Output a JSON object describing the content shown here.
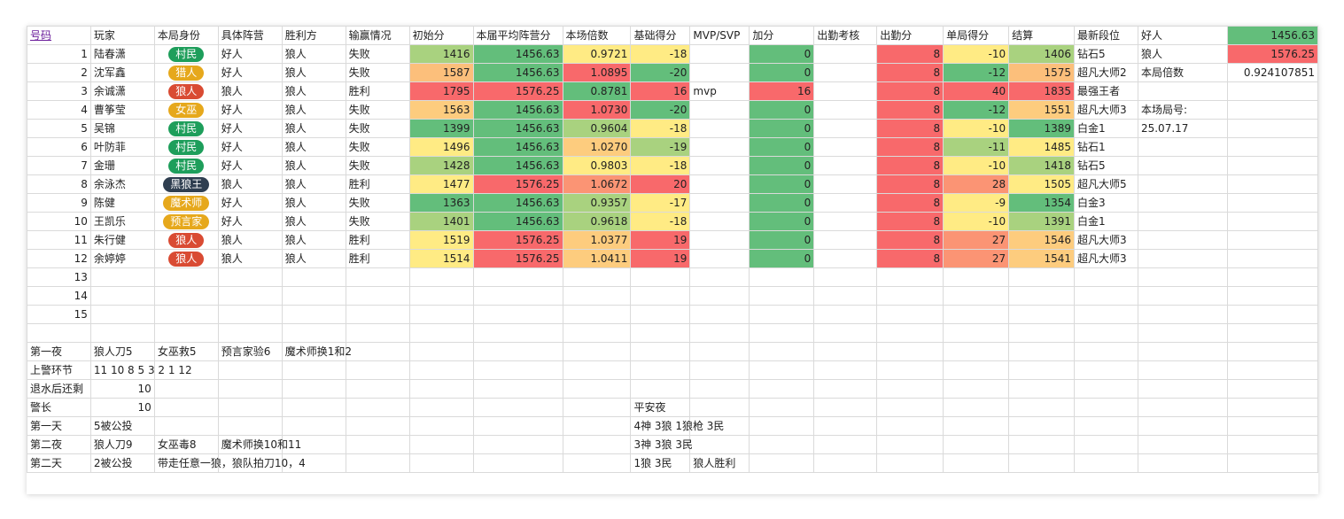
{
  "colors": {
    "green": "#63be7b",
    "lightgreen": "#a9d27f",
    "yellow": "#ffeb84",
    "orange": "#fcbf7b",
    "lightorange": "#fdcc7e",
    "salmon": "#fb9474",
    "red": "#f8696b",
    "pill_green": "#1e9e5b",
    "pill_yellow": "#e6a81c",
    "pill_red": "#d94b33",
    "pill_dark": "#2f3e50"
  },
  "headers": [
    "号码",
    "玩家",
    "本局身份",
    "具体阵营",
    "胜利方",
    "输赢情况",
    "初始分",
    "本届平均阵营分",
    "本场倍数",
    "基础得分",
    "MVP/SVP",
    "加分",
    "出勤考核",
    "出勤分",
    "单局得分",
    "结算",
    "最新段位",
    "好人",
    "1456.63"
  ],
  "side": {
    "r1": {
      "label": "狼人",
      "value": "1576.25"
    },
    "r2": {
      "label": "本局倍数",
      "value": "0.924107851"
    },
    "r4": {
      "label": "本场局号:"
    },
    "r5": {
      "label": "25.07.17"
    }
  },
  "players": [
    {
      "no": "1",
      "name": "陆春潇",
      "role": "村民",
      "pill": "green",
      "camp": "好人",
      "winner": "狼人",
      "result": "失败",
      "init": "1416",
      "avg": "1456.63",
      "mult": "0.9721",
      "base": "-18",
      "mvp": "",
      "bonus": "0",
      "att": "",
      "att_score": "8",
      "game": "-10",
      "settle": "1406",
      "rank": "钻石5",
      "c_init": "lightgreen",
      "c_avg": "green",
      "c_mult": "yellow",
      "c_base": "yellow",
      "c_game": "yellow",
      "c_settle": "lightgreen"
    },
    {
      "no": "2",
      "name": "沈军鑫",
      "role": "猎人",
      "pill": "yellow",
      "camp": "好人",
      "winner": "狼人",
      "result": "失败",
      "init": "1587",
      "avg": "1456.63",
      "mult": "1.0895",
      "base": "-20",
      "mvp": "",
      "bonus": "0",
      "att": "",
      "att_score": "8",
      "game": "-12",
      "settle": "1575",
      "rank": "超凡大师2",
      "c_init": "orange",
      "c_avg": "green",
      "c_mult": "red",
      "c_base": "green",
      "c_game": "green",
      "c_settle": "orange"
    },
    {
      "no": "3",
      "name": "余诚潇",
      "role": "狼人",
      "pill": "red",
      "camp": "狼人",
      "winner": "狼人",
      "result": "胜利",
      "init": "1795",
      "avg": "1576.25",
      "mult": "0.8781",
      "base": "16",
      "mvp": "mvp",
      "bonus": "16",
      "att": "",
      "att_score": "8",
      "game": "40",
      "settle": "1835",
      "rank": "最强王者",
      "c_init": "red",
      "c_avg": "red",
      "c_mult": "green",
      "c_base": "red",
      "c_game": "red",
      "c_settle": "red",
      "c_bonus": "red"
    },
    {
      "no": "4",
      "name": "曹筝莹",
      "role": "女巫",
      "pill": "yellow",
      "camp": "好人",
      "winner": "狼人",
      "result": "失败",
      "init": "1563",
      "avg": "1456.63",
      "mult": "1.0730",
      "base": "-20",
      "mvp": "",
      "bonus": "0",
      "att": "",
      "att_score": "8",
      "game": "-12",
      "settle": "1551",
      "rank": "超凡大师3",
      "c_init": "lightorange",
      "c_avg": "green",
      "c_mult": "red",
      "c_base": "green",
      "c_game": "green",
      "c_settle": "lightorange"
    },
    {
      "no": "5",
      "name": "吴锦",
      "role": "村民",
      "pill": "green",
      "camp": "好人",
      "winner": "狼人",
      "result": "失败",
      "init": "1399",
      "avg": "1456.63",
      "mult": "0.9604",
      "base": "-18",
      "mvp": "",
      "bonus": "0",
      "att": "",
      "att_score": "8",
      "game": "-10",
      "settle": "1389",
      "rank": "白金1",
      "c_init": "green",
      "c_avg": "green",
      "c_mult": "lightgreen",
      "c_base": "yellow",
      "c_game": "yellow",
      "c_settle": "green"
    },
    {
      "no": "6",
      "name": "叶防菲",
      "role": "村民",
      "pill": "green",
      "camp": "好人",
      "winner": "狼人",
      "result": "失败",
      "init": "1496",
      "avg": "1456.63",
      "mult": "1.0270",
      "base": "-19",
      "mvp": "",
      "bonus": "0",
      "att": "",
      "att_score": "8",
      "game": "-11",
      "settle": "1485",
      "rank": "钻石1",
      "c_init": "yellow",
      "c_avg": "green",
      "c_mult": "lightorange",
      "c_base": "lightgreen",
      "c_game": "lightgreen",
      "c_settle": "yellow"
    },
    {
      "no": "7",
      "name": "金珊",
      "role": "村民",
      "pill": "green",
      "camp": "好人",
      "winner": "狼人",
      "result": "失败",
      "init": "1428",
      "avg": "1456.63",
      "mult": "0.9803",
      "base": "-18",
      "mvp": "",
      "bonus": "0",
      "att": "",
      "att_score": "8",
      "game": "-10",
      "settle": "1418",
      "rank": "钻石5",
      "c_init": "lightgreen",
      "c_avg": "green",
      "c_mult": "yellow",
      "c_base": "yellow",
      "c_game": "yellow",
      "c_settle": "lightgreen"
    },
    {
      "no": "8",
      "name": "余泳杰",
      "role": "黑狼王",
      "pill": "dark",
      "camp": "狼人",
      "winner": "狼人",
      "result": "胜利",
      "init": "1477",
      "avg": "1576.25",
      "mult": "1.0672",
      "base": "20",
      "mvp": "",
      "bonus": "0",
      "att": "",
      "att_score": "8",
      "game": "28",
      "settle": "1505",
      "rank": "超凡大师5",
      "c_init": "yellow",
      "c_avg": "red",
      "c_mult": "salmon",
      "c_base": "red",
      "c_game": "salmon",
      "c_settle": "yellow"
    },
    {
      "no": "9",
      "name": "陈健",
      "role": "魔术师",
      "pill": "yellow",
      "camp": "好人",
      "winner": "狼人",
      "result": "失败",
      "init": "1363",
      "avg": "1456.63",
      "mult": "0.9357",
      "base": "-17",
      "mvp": "",
      "bonus": "0",
      "att": "",
      "att_score": "8",
      "game": "-9",
      "settle": "1354",
      "rank": "白金3",
      "c_init": "green",
      "c_avg": "green",
      "c_mult": "lightgreen",
      "c_base": "yellow",
      "c_game": "yellow",
      "c_settle": "green"
    },
    {
      "no": "10",
      "name": "王凯乐",
      "role": "预言家",
      "pill": "yellow",
      "camp": "好人",
      "winner": "狼人",
      "result": "失败",
      "init": "1401",
      "avg": "1456.63",
      "mult": "0.9618",
      "base": "-18",
      "mvp": "",
      "bonus": "0",
      "att": "",
      "att_score": "8",
      "game": "-10",
      "settle": "1391",
      "rank": "白金1",
      "c_init": "lightgreen",
      "c_avg": "green",
      "c_mult": "lightgreen",
      "c_base": "yellow",
      "c_game": "yellow",
      "c_settle": "lightgreen"
    },
    {
      "no": "11",
      "name": "朱行健",
      "role": "狼人",
      "pill": "red",
      "camp": "狼人",
      "winner": "狼人",
      "result": "胜利",
      "init": "1519",
      "avg": "1576.25",
      "mult": "1.0377",
      "base": "19",
      "mvp": "",
      "bonus": "0",
      "att": "",
      "att_score": "8",
      "game": "27",
      "settle": "1546",
      "rank": "超凡大师3",
      "c_init": "yellow",
      "c_avg": "red",
      "c_mult": "lightorange",
      "c_base": "red",
      "c_game": "salmon",
      "c_settle": "lightorange"
    },
    {
      "no": "12",
      "name": "余婷婷",
      "role": "狼人",
      "pill": "red",
      "camp": "狼人",
      "winner": "狼人",
      "result": "胜利",
      "init": "1514",
      "avg": "1576.25",
      "mult": "1.0411",
      "base": "19",
      "mvp": "",
      "bonus": "0",
      "att": "",
      "att_score": "8",
      "game": "27",
      "settle": "1541",
      "rank": "超凡大师3",
      "c_init": "yellow",
      "c_avg": "red",
      "c_mult": "lightorange",
      "c_base": "red",
      "c_game": "salmon",
      "c_settle": "lightorange"
    }
  ],
  "empty_rows": [
    "13",
    "14",
    "15"
  ],
  "notes": [
    {
      "a": "第一夜",
      "b": "狼人刀5",
      "c": "女巫救5",
      "d": "预言家验6",
      "e": "魔术师换1和2",
      "j": "",
      "k": ""
    },
    {
      "a": "上警环节",
      "b": "11 10 8 5 3 2 1 12",
      "c": "",
      "d": "",
      "e": "",
      "j": "",
      "k": ""
    },
    {
      "a": "退水后还剩",
      "b_num": "10",
      "c": "",
      "d": "",
      "e": "",
      "j": "",
      "k": ""
    },
    {
      "a": "警长",
      "b_num": "10",
      "c": "",
      "d": "",
      "e": "",
      "j": "平安夜",
      "k": ""
    },
    {
      "a": "第一天",
      "b": "5被公投",
      "c": "",
      "d": "",
      "e": "",
      "j": "4神 3狼 1狼枪 3民",
      "k": ""
    },
    {
      "a": "第二夜",
      "b": "狼人刀9",
      "c": "女巫毒8",
      "d": "魔术师换10和11",
      "e": "",
      "j": "3神 3狼 3民",
      "k": ""
    },
    {
      "a": "第二天",
      "b": "2被公投",
      "c": "带走任意一狼，狼队拍刀10，4",
      "d": "",
      "e": "",
      "j": "1狼 3民",
      "k": "狼人胜利"
    }
  ]
}
